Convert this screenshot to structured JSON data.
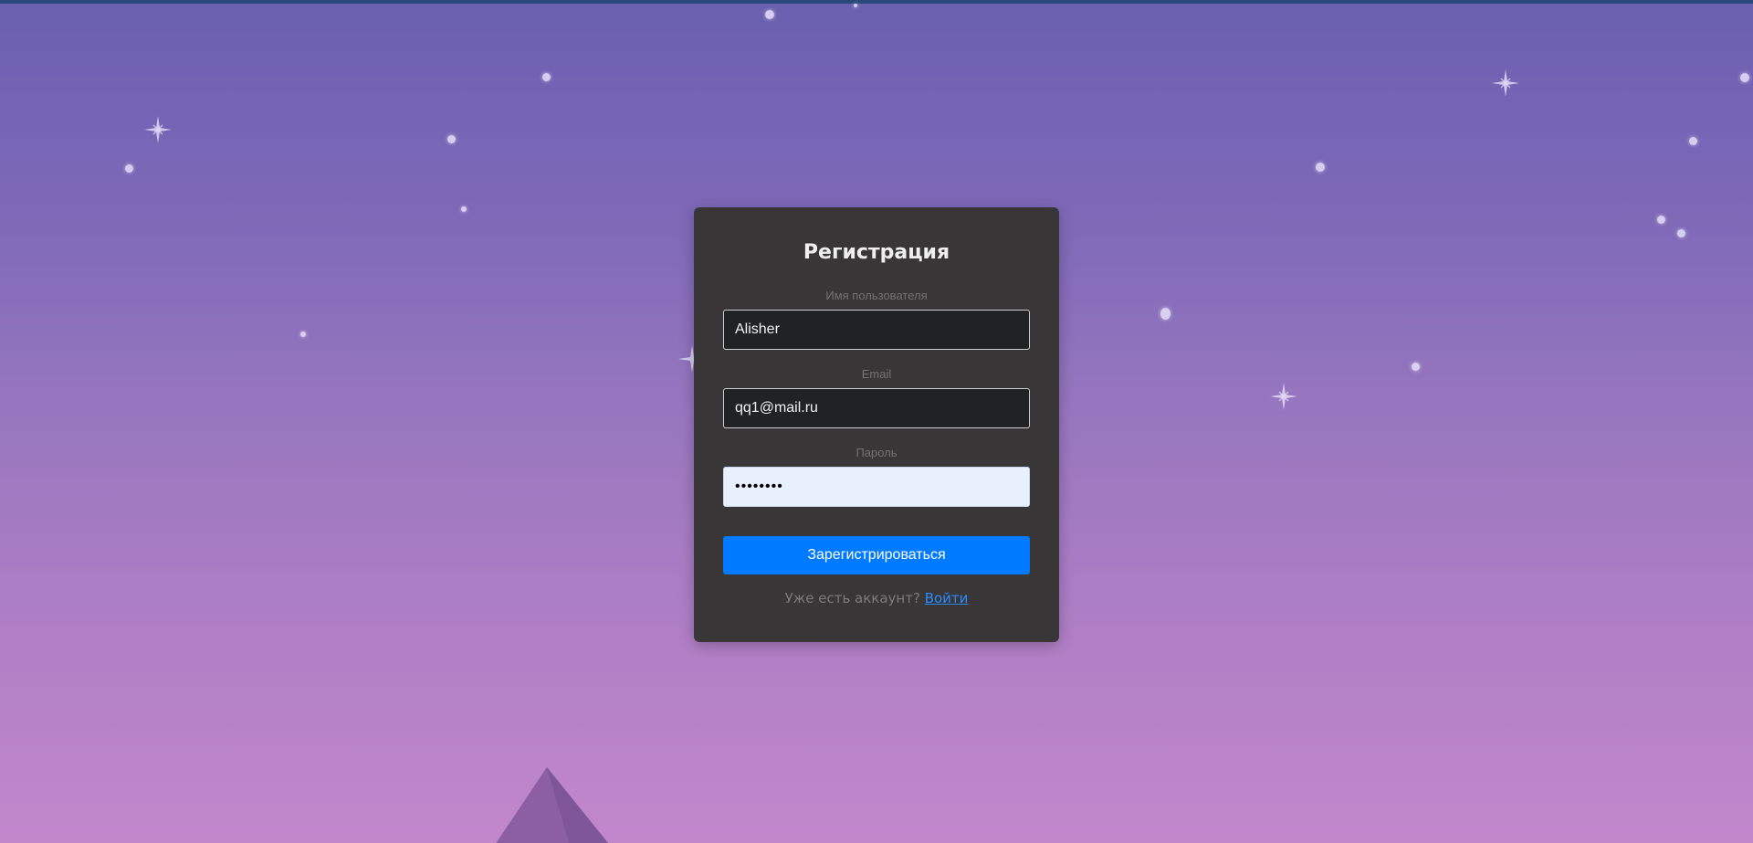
{
  "form": {
    "title": "Регистрация",
    "username_label": "Имя пользователя",
    "username_value": "Alisher",
    "email_label": "Email",
    "email_value": "qq1@mail.ru",
    "password_label": "Пароль",
    "password_value": "••••••••",
    "submit_label": "Зарегистрироваться",
    "have_account_text": "Уже есть аккаунт?",
    "login_link_label": "Войти"
  },
  "colors": {
    "card": "#383636",
    "primary_button": "#007bff",
    "link": "#2c8cff",
    "field_dark": "#212224",
    "field_autofill": "#e8f0fe"
  },
  "decorations": {
    "background_icon": "starry-sky",
    "mountain_icon": "mountain-peak"
  }
}
